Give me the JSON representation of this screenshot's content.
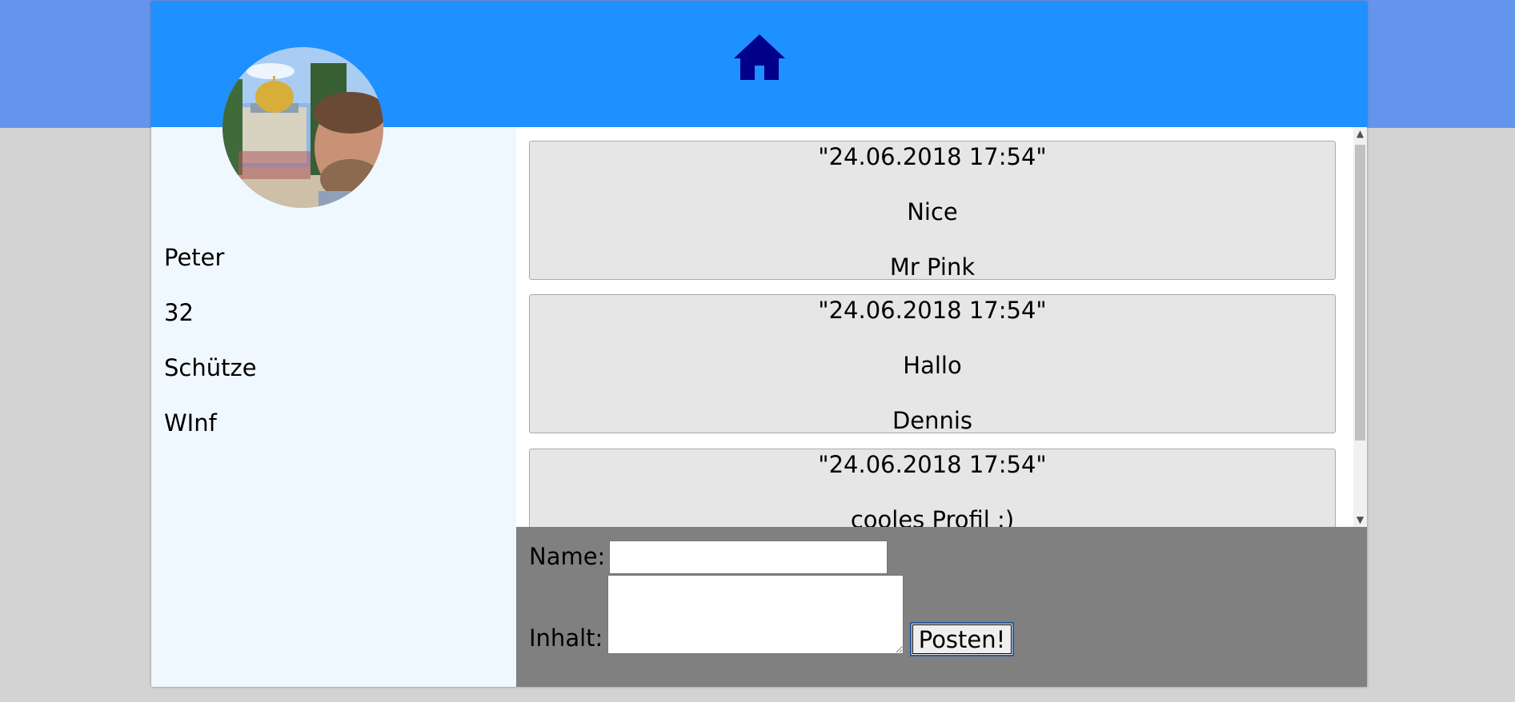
{
  "profile": {
    "name": "Peter",
    "age": "32",
    "zodiac": "Schütze",
    "field": "WInf"
  },
  "posts": [
    {
      "date": "\"24.06.2018 17:54\"",
      "content": "Nice",
      "author": "Mr Pink"
    },
    {
      "date": "\"24.06.2018 17:54\"",
      "content": "Hallo",
      "author": "Dennis"
    },
    {
      "date": "\"24.06.2018 17:54\"",
      "content": "cooles Profil :)",
      "author": ""
    }
  ],
  "form": {
    "name_label": "Name:",
    "content_label": "Inhalt:",
    "name_value": "",
    "content_value": "",
    "submit_label": "Posten!"
  },
  "icons": {
    "home": "home-icon",
    "scroll_up": "chevron-up-icon",
    "scroll_down": "chevron-down-icon"
  },
  "colors": {
    "top_band": "#6495ed",
    "header": "#1e90ff",
    "home_icon": "#00008b",
    "sidebar": "#f0f8ff",
    "post_bg": "#e6e6e6",
    "form_bg": "#808080",
    "page_bg": "#d3d3d3"
  }
}
